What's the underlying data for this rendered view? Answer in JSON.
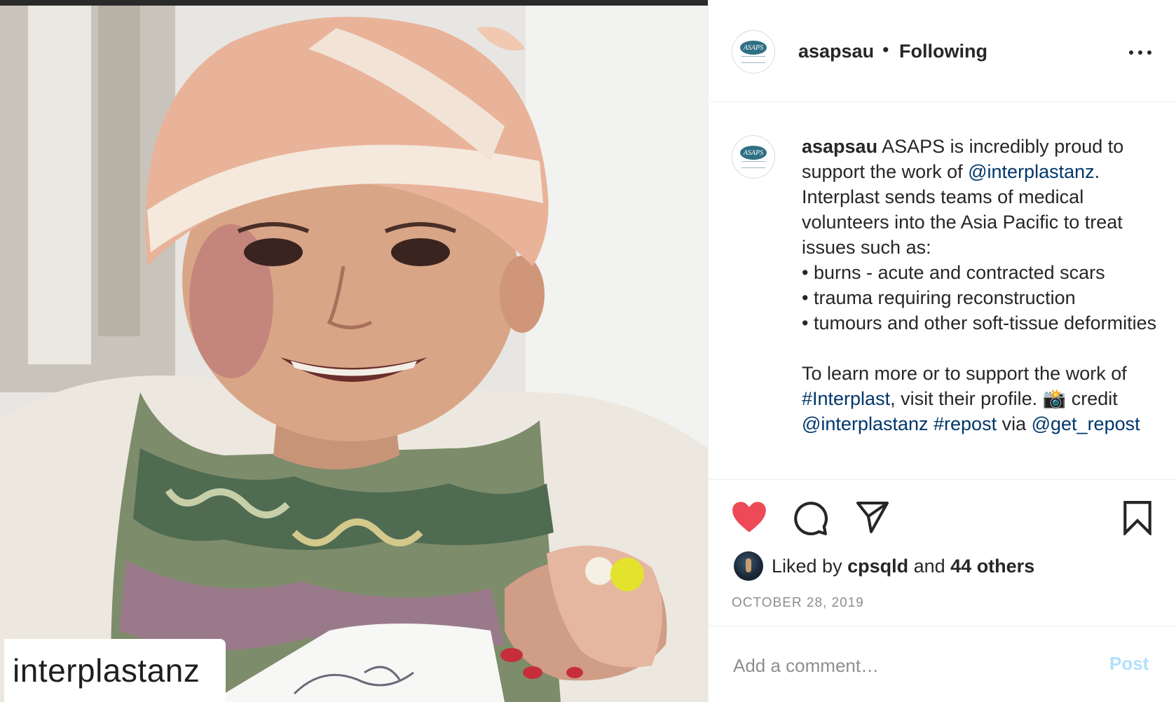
{
  "photo": {
    "watermark": "interplastanz"
  },
  "header": {
    "username": "asapsau",
    "separator": "•",
    "follow_status": "Following"
  },
  "caption": {
    "username": "asapsau",
    "line1_text": " ASAPS is incredibly proud to support the work of ",
    "mention1": "@interplastanz",
    "line1_end": ". Interplast sends teams of medical volunteers into the Asia Pacific to treat issues such as:",
    "bullets": [
      "• burns - acute and contracted scars",
      "• trauma requiring reconstruction",
      "• tumours and other soft-tissue deformities"
    ],
    "p2_start": "To learn more or to support the work of ",
    "hashtag1": "#Interplast",
    "p2_mid": ", visit their profile. 📸 credit ",
    "mention2": "@interplastanz",
    "p2_space": " ",
    "hashtag2": "#repost",
    "p2_via": " via ",
    "mention3": "@get_repost"
  },
  "likes": {
    "prefix": "Liked by ",
    "user": "cpsqld",
    "and": " and ",
    "others": "44 others"
  },
  "date": "OCTOBER 28, 2019",
  "comment": {
    "placeholder": "Add a comment…",
    "post_label": "Post"
  },
  "colors": {
    "heart": "#ed4956",
    "link": "#00376b",
    "post_disabled": "#b2dffc",
    "muted": "#8e8e8e"
  }
}
